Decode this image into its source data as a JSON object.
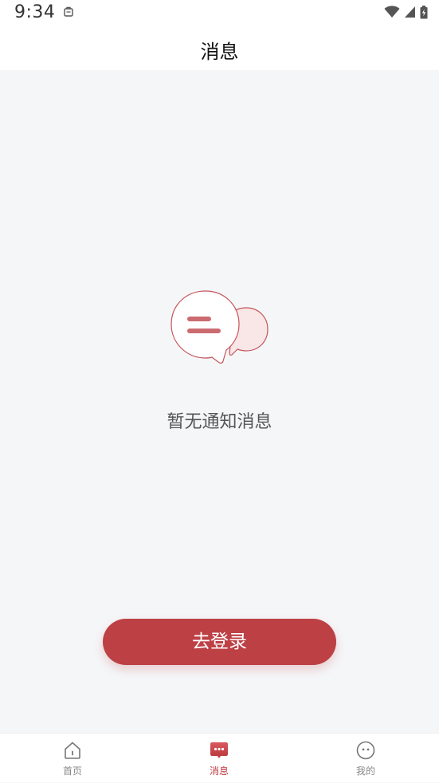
{
  "status_bar": {
    "time": "9:34"
  },
  "header": {
    "title": "消息"
  },
  "empty_state": {
    "message": "暂无通知消息"
  },
  "login_button": {
    "label": "去登录"
  },
  "tab_bar": {
    "tabs": [
      {
        "label": "首页",
        "icon": "home-icon",
        "active": false
      },
      {
        "label": "消息",
        "icon": "message-icon",
        "active": true
      },
      {
        "label": "我的",
        "icon": "profile-icon",
        "active": false
      }
    ]
  },
  "colors": {
    "accent": "#bd4045",
    "active_tab": "#c0393e",
    "background": "#f5f6f8"
  }
}
